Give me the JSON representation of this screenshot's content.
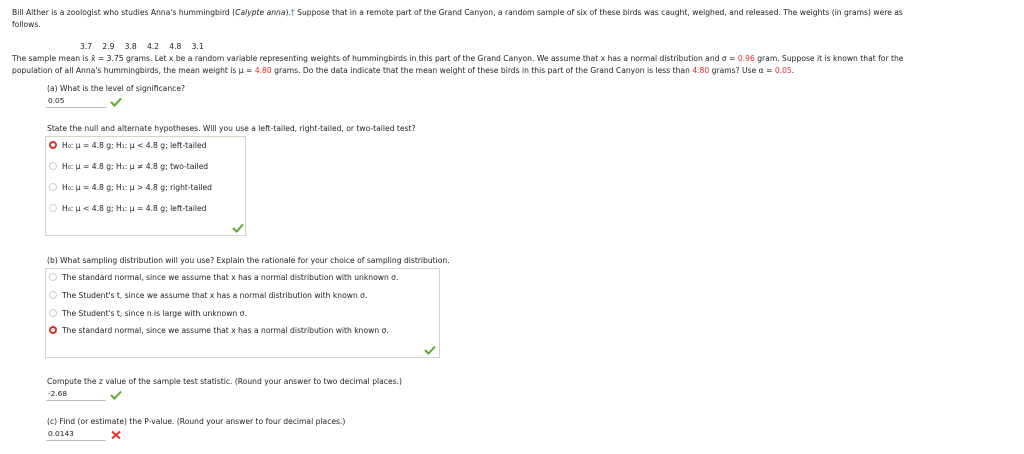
{
  "intro": {
    "line1_a": "Bill Alther is a zoologist who studies Anna's hummingbird (",
    "line1_species": "Calypte anna",
    "line1_b": ").",
    "line1_dagger": "†",
    "line1_c": " Suppose that in a remote part of the Grand Canyon, a random sample of six of these birds was caught, weighed, and released. The weights (in grams) were as",
    "line2": "follows."
  },
  "weights": "3.7   2.9   3.8   4.2   4.8   3.1",
  "mean_text": {
    "a": "The sample mean is x̄ = 3.75 grams. Let x be a random variable representing weights of hummingbirds in this part of the Grand Canyon. We assume that x has a normal distribution and σ = ",
    "sigma": "0.96",
    "b": " gram. Suppose it is known that for the",
    "c": "population of all Anna's hummingbirds, the mean weight is μ = ",
    "mu": "4.80",
    "d": " grams. Do the data indicate that the mean weight of these birds in this part of the Grand Canyon is less than ",
    "mu2": "4.80",
    "e": " grams? Use α = ",
    "alpha": "0.05",
    "f": "."
  },
  "part_a": {
    "question": "(a) What is the level of significance?",
    "answer": "0.05"
  },
  "hypotheses": {
    "question": "State the null and alternate hypotheses. Will you use a left-tailed, right-tailed, or two-tailed test?",
    "options": [
      "H₀: μ = 4.8 g; H₁: μ < 4.8 g; left-tailed",
      "H₀: μ = 4.8 g; H₁: μ ≠ 4.8 g; two-tailed",
      "H₀: μ = 4.8 g; H₁: μ > 4.8 g; right-tailed",
      "H₀: μ < 4.8 g; H₁: μ = 4.8 g; left-tailed"
    ],
    "selected": 0
  },
  "part_b": {
    "question": "(b) What sampling distribution will you use? Explain the rationale for your choice of sampling distribution.",
    "options": [
      "The standard normal, since we assume that x has a normal distribution with unknown σ.",
      "The Student's t, since we assume that x has a normal distribution with known σ.",
      "The Student's t, since n is large with unknown σ.",
      "The standard normal, since we assume that x has a normal distribution with known σ."
    ],
    "selected": 3
  },
  "z_value": {
    "question": "Compute the z value of the sample test statistic. (Round your answer to two decimal places.)",
    "answer": "-2.68"
  },
  "part_c": {
    "question": "(c) Find (or estimate) the P-value. (Round your answer to four decimal places.)",
    "answer": "0.0143"
  },
  "colors": {
    "correct": "#5aa832",
    "incorrect": "#e0302a",
    "highlight": "#e0302a"
  }
}
